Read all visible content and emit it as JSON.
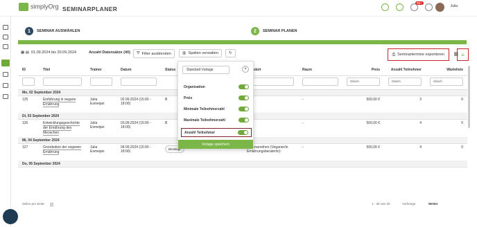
{
  "app": {
    "brand": "simplyOrg",
    "title": "SEMINARPLANER",
    "user": "Julia",
    "notif_count": "99+"
  },
  "steps": [
    {
      "num": "1",
      "label": "SEMINAR AUSWÄHLEN",
      "color": "#2f4a61"
    },
    {
      "num": "2",
      "label": "SEMINAR PLANEN",
      "color": "#7ab648"
    }
  ],
  "progress": 1.0,
  "toolbar": {
    "date_range": "01.09.2024 bis 30.09.2024",
    "record_count": "Anzahl Datensätze (40)",
    "filter_hide": "Filter ausblenden",
    "columns": "Spalten verwalten",
    "export": "Seminartermine exportieren"
  },
  "table": {
    "headers": [
      "ID",
      "Titel",
      "Trainer",
      "Datum",
      "Status",
      "",
      "Standort",
      "Raum",
      "Preis",
      "Anzahl Teilnehmer",
      "Warteliste"
    ],
    "filter_values": {
      "preis": "Gleich",
      "teilnehmer": "Gleich",
      "warteliste": "Gleich"
    },
    "groups": [
      {
        "label": "Mo, 02 September 2024",
        "rows": [
          {
            "id": "125",
            "title": "Einführung in vegane Ernährung",
            "trainer": "Julia Esmeijan",
            "date": "02.09.2024 (15:00 - 18:00)",
            "status": "B",
            "standort": "",
            "raum": "-",
            "preis": "500,00 €",
            "teilnehmer": "3",
            "warteliste": "0"
          }
        ]
      },
      {
        "label": "Di, 03 September 2024",
        "rows": [
          {
            "id": "126",
            "title": "Entwicklungsgeschichte der Ernährung des Menschen",
            "trainer": "Julia Esmeijan",
            "date": "03.09.2024 (15:00 - 18:00)",
            "status": "B",
            "standort": "",
            "raum": "-",
            "preis": "500,00 €",
            "teilnehmer": "4",
            "warteliste": "0"
          }
        ]
      },
      {
        "label": "Mi, 04 September 2024",
        "rows": [
          {
            "id": "127",
            "title": "Grundsätze der veganen Ernährung",
            "trainer": "Julia Esmeijan",
            "date": "04.09.2024 (15:00 - 18:00)",
            "status": "Bestätigt",
            "standort": "Seminarreihen (Veganer/in Ernährungsberater/in)",
            "raum": "-",
            "preis": "500,00 €",
            "teilnehmer": "4",
            "warteliste": "0"
          }
        ]
      },
      {
        "label": "Do, 05 September 2024",
        "rows": []
      }
    ]
  },
  "footer": {
    "rows_label": "Zeilen pro Seite:",
    "rows_value": "30",
    "range": "1 - 30 von 40",
    "prev": "Vorherige",
    "next": "Weiter"
  },
  "dropdown": {
    "template": "Standard Vorlage",
    "items": [
      "Organisation",
      "Preis",
      "Minimale Teilnehmerzahl",
      "Maximale Teilnehmerzahl",
      "Anzahl Teilnehmer"
    ],
    "save": "Vorlage speichern"
  }
}
